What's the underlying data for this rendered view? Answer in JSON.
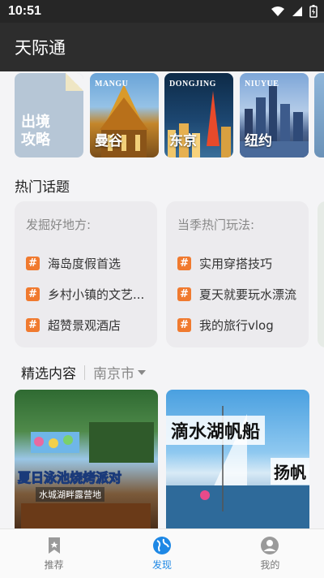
{
  "status": {
    "time": "10:51"
  },
  "app": {
    "title": "天际通"
  },
  "destinations": [
    {
      "cn": "出境\n攻略",
      "en": ""
    },
    {
      "cn": "曼谷",
      "en": "MANGU"
    },
    {
      "cn": "东京",
      "en": "DONGJING"
    },
    {
      "cn": "纽约",
      "en": "NIUYUE"
    }
  ],
  "hot_topics": {
    "title": "热门话题",
    "cards": [
      {
        "heading": "发掘好地方:",
        "items": [
          "海岛度假首选",
          "乡村小镇的文艺...",
          "超赞景观酒店"
        ]
      },
      {
        "heading": "当季热门玩法:",
        "items": [
          "实用穿搭技巧",
          "夏天就要玩水漂流",
          "我的旅行vlog"
        ]
      }
    ]
  },
  "featured": {
    "title": "精选内容",
    "city": "南京市",
    "cards": [
      {
        "caption": "夏日泳池烧烤派对",
        "subcaption": "水城湖畔露营地"
      },
      {
        "caption": "滴水湖帆船",
        "subcaption": "扬帆"
      }
    ]
  },
  "bottom_nav": [
    {
      "label": "推荐",
      "icon": "bookmark-icon",
      "active": false
    },
    {
      "label": "发现",
      "icon": "globe-icon",
      "active": true
    },
    {
      "label": "我的",
      "icon": "user-icon",
      "active": false
    }
  ],
  "colors": {
    "accent": "#1e88e5",
    "hashtag": "#f07a2f",
    "appbar": "#2d2d2d"
  }
}
